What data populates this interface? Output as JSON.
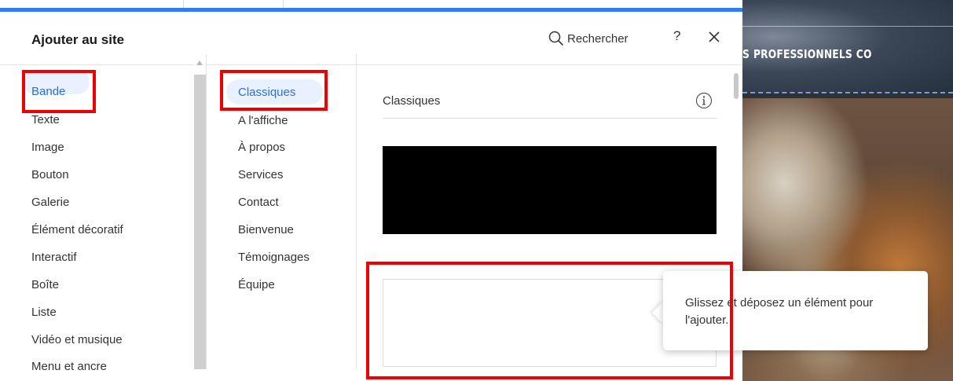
{
  "background_site": {
    "nav_fragments": [
      "S",
      "PROFESSIONNELS",
      "CO"
    ]
  },
  "panel": {
    "title": "Ajouter au site",
    "search_label": "Rechercher",
    "help_label": "?"
  },
  "categories": [
    {
      "label": "Bande",
      "active": true
    },
    {
      "label": "Texte"
    },
    {
      "label": "Image"
    },
    {
      "label": "Bouton"
    },
    {
      "label": "Galerie"
    },
    {
      "label": "Élément décoratif"
    },
    {
      "label": "Interactif"
    },
    {
      "label": "Boîte"
    },
    {
      "label": "Liste"
    },
    {
      "label": "Vidéo et musique"
    },
    {
      "label": "Menu et ancre"
    }
  ],
  "subcategories": [
    {
      "label": "Classiques",
      "active": true
    },
    {
      "label": "A l'affiche"
    },
    {
      "label": "À propos"
    },
    {
      "label": "Services"
    },
    {
      "label": "Contact"
    },
    {
      "label": "Bienvenue"
    },
    {
      "label": "Témoignages"
    },
    {
      "label": "Équipe"
    }
  ],
  "content": {
    "section_title": "Classiques",
    "info_icon": "info-icon"
  },
  "tooltip": {
    "text": "Glissez et déposez un élément pour l'ajouter."
  },
  "colors": {
    "accent": "#2b7ff0",
    "active_text": "#2b6fe0",
    "active_bg": "#e8f1fd",
    "highlight": "#f00000"
  }
}
